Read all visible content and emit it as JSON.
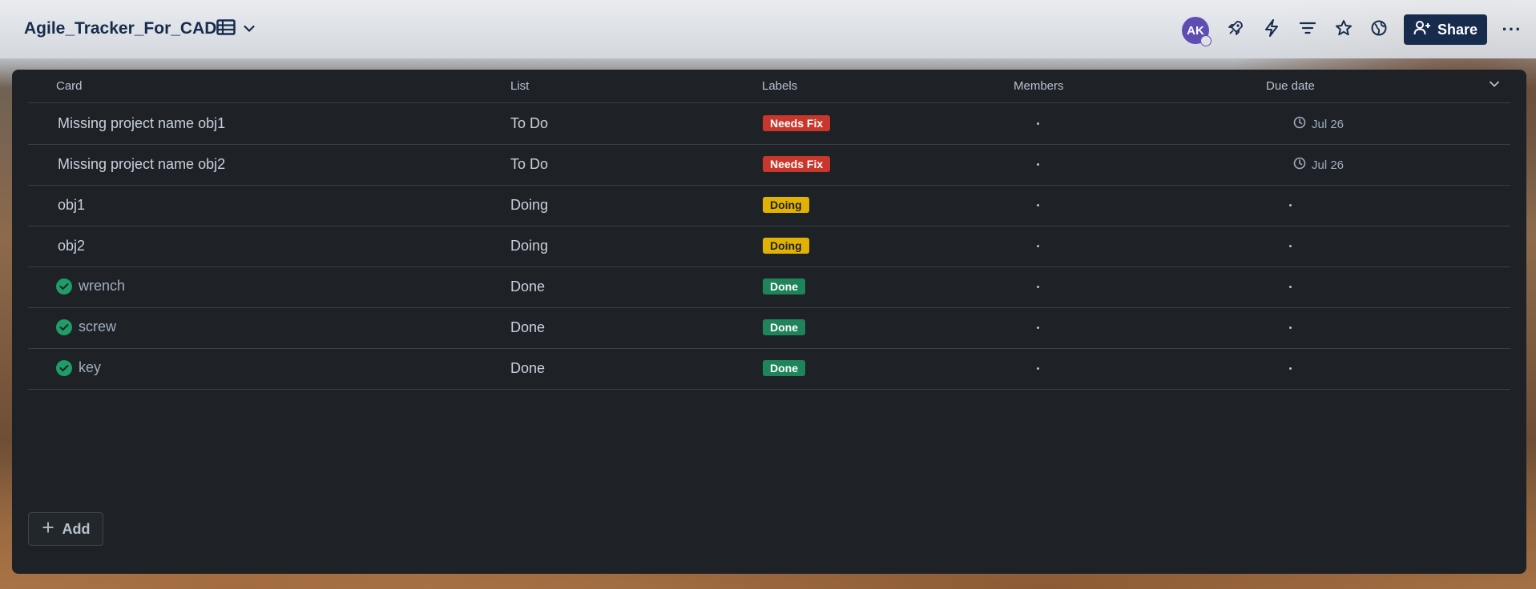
{
  "board": {
    "title": "Agile_Tracker_For_CAD"
  },
  "header": {
    "view_icon": "table-icon",
    "avatar_initials": "AK",
    "share_label": "Share",
    "more_label": "···",
    "icons": [
      "rocket-icon",
      "bolt-icon",
      "filter-icon",
      "star-icon",
      "globe-icon"
    ]
  },
  "table": {
    "columns": {
      "card": "Card",
      "list": "List",
      "labels": "Labels",
      "members": "Members",
      "due": "Due date"
    },
    "rows": [
      {
        "card": "Missing project name obj1",
        "done": false,
        "list": "To Do",
        "label": "Needs Fix",
        "label_color": "#c9372c",
        "due": "Jul 26"
      },
      {
        "card": "Missing project name obj2",
        "done": false,
        "list": "To Do",
        "label": "Needs Fix",
        "label_color": "#c9372c",
        "due": "Jul 26"
      },
      {
        "card": "obj1",
        "done": false,
        "list": "Doing",
        "label": "Doing",
        "label_color": "#e2b203",
        "due": ""
      },
      {
        "card": "obj2",
        "done": false,
        "list": "Doing",
        "label": "Doing",
        "label_color": "#e2b203",
        "due": ""
      },
      {
        "card": "wrench",
        "done": true,
        "list": "Done",
        "label": "Done",
        "label_color": "#1f845a",
        "due": ""
      },
      {
        "card": "screw",
        "done": true,
        "list": "Done",
        "label": "Done",
        "label_color": "#1f845a",
        "due": ""
      },
      {
        "card": "key",
        "done": true,
        "list": "Done",
        "label": "Done",
        "label_color": "#1f845a",
        "due": ""
      }
    ]
  },
  "footer": {
    "add_label": "Add"
  },
  "colors": {
    "panel": "#1e2227",
    "share": "#172b4d",
    "done_check": "#1f9d66"
  }
}
